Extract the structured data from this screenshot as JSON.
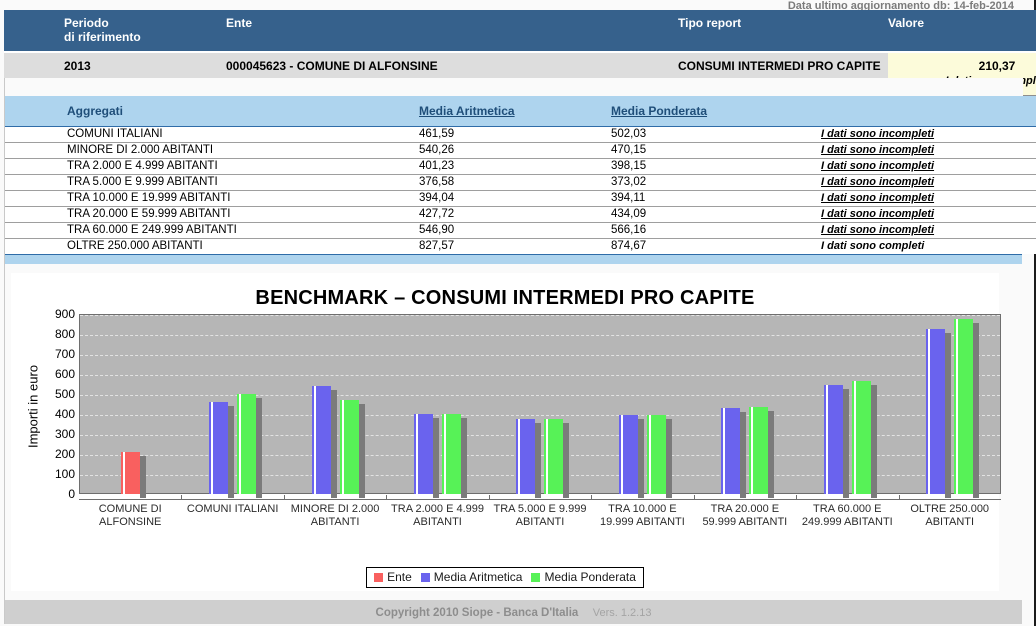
{
  "meta": {
    "update_label": "Data ultimo aggiornamento db: 14-feb-2014"
  },
  "header": {
    "columns": {
      "periodo_line1": "Periodo",
      "periodo_line2": "di riferimento",
      "ente": "Ente",
      "tipo_report": "Tipo report",
      "valore": "Valore"
    },
    "row": {
      "periodo": "2013",
      "ente": "000045623 - COMUNE DI ALFONSINE",
      "tipo_report": "CONSUMI INTERMEDI PRO CAPITE",
      "valore": "210,37",
      "valore_status": "I dati sono completi"
    }
  },
  "aggregates": {
    "columns": {
      "nome": "Aggregati",
      "media_aritmetica": "Media Aritmetica",
      "media_ponderata": "Media Ponderata",
      "stato": ""
    },
    "rows": [
      {
        "nome": "COMUNI ITALIANI",
        "aritmetica": "461,59",
        "ponderata": "502,03",
        "stato": "I dati sono incompleti",
        "stato_link": true
      },
      {
        "nome": "MINORE DI 2.000 ABITANTI",
        "aritmetica": "540,26",
        "ponderata": "470,15",
        "stato": "I dati sono incompleti",
        "stato_link": true
      },
      {
        "nome": "TRA 2.000 E 4.999 ABITANTI",
        "aritmetica": "401,23",
        "ponderata": "398,15",
        "stato": "I dati sono incompleti",
        "stato_link": true
      },
      {
        "nome": "TRA 5.000 E 9.999 ABITANTI",
        "aritmetica": "376,58",
        "ponderata": "373,02",
        "stato": "I dati sono incompleti",
        "stato_link": true
      },
      {
        "nome": "TRA 10.000 E 19.999 ABITANTI",
        "aritmetica": "394,04",
        "ponderata": "394,11",
        "stato": "I dati sono incompleti",
        "stato_link": true
      },
      {
        "nome": "TRA 20.000 E 59.999 ABITANTI",
        "aritmetica": "427,72",
        "ponderata": "434,09",
        "stato": "I dati sono incompleti",
        "stato_link": true
      },
      {
        "nome": "TRA 60.000 E 249.999 ABITANTI",
        "aritmetica": "546,90",
        "ponderata": "566,16",
        "stato": "I dati sono incompleti",
        "stato_link": true
      },
      {
        "nome": "OLTRE 250.000 ABITANTI",
        "aritmetica": "827,57",
        "ponderata": "874,67",
        "stato": "I dati sono completi",
        "stato_link": false
      }
    ]
  },
  "chart_data": {
    "type": "bar",
    "title": "BENCHMARK – CONSUMI INTERMEDI PRO CAPITE",
    "xlabel": "",
    "ylabel": "Importi in euro",
    "ylim": [
      0,
      900
    ],
    "yticks": [
      0,
      100,
      200,
      300,
      400,
      500,
      600,
      700,
      800,
      900
    ],
    "grid": true,
    "legend_position": "bottom",
    "categories": [
      "COMUNE DI ALFONSINE",
      "COMUNI ITALIANI",
      "MINORE DI 2.000 ABITANTI",
      "TRA 2.000 E 4.999 ABITANTI",
      "TRA 5.000 E 9.999 ABITANTI",
      "TRA 10.000 E 19.999 ABITANTI",
      "TRA 20.000 E 59.999 ABITANTI",
      "TRA 60.000 E 249.999 ABITANTI",
      "OLTRE 250.000 ABITANTI"
    ],
    "series": [
      {
        "name": "Ente",
        "color": "#f9605f",
        "values": [
          210.37,
          null,
          null,
          null,
          null,
          null,
          null,
          null,
          null
        ]
      },
      {
        "name": "Media Aritmetica",
        "color": "#6a63ee",
        "values": [
          null,
          461.59,
          540.26,
          401.23,
          376.58,
          394.04,
          427.72,
          546.9,
          827.57
        ]
      },
      {
        "name": "Media Ponderata",
        "color": "#57f257",
        "values": [
          null,
          502.03,
          470.15,
          398.15,
          373.02,
          394.11,
          434.09,
          566.16,
          874.67
        ]
      }
    ]
  },
  "footer": {
    "copyright": "Copyright 2010 Siope - Banca D'Italia",
    "version": "Vers. 1.2.13"
  }
}
